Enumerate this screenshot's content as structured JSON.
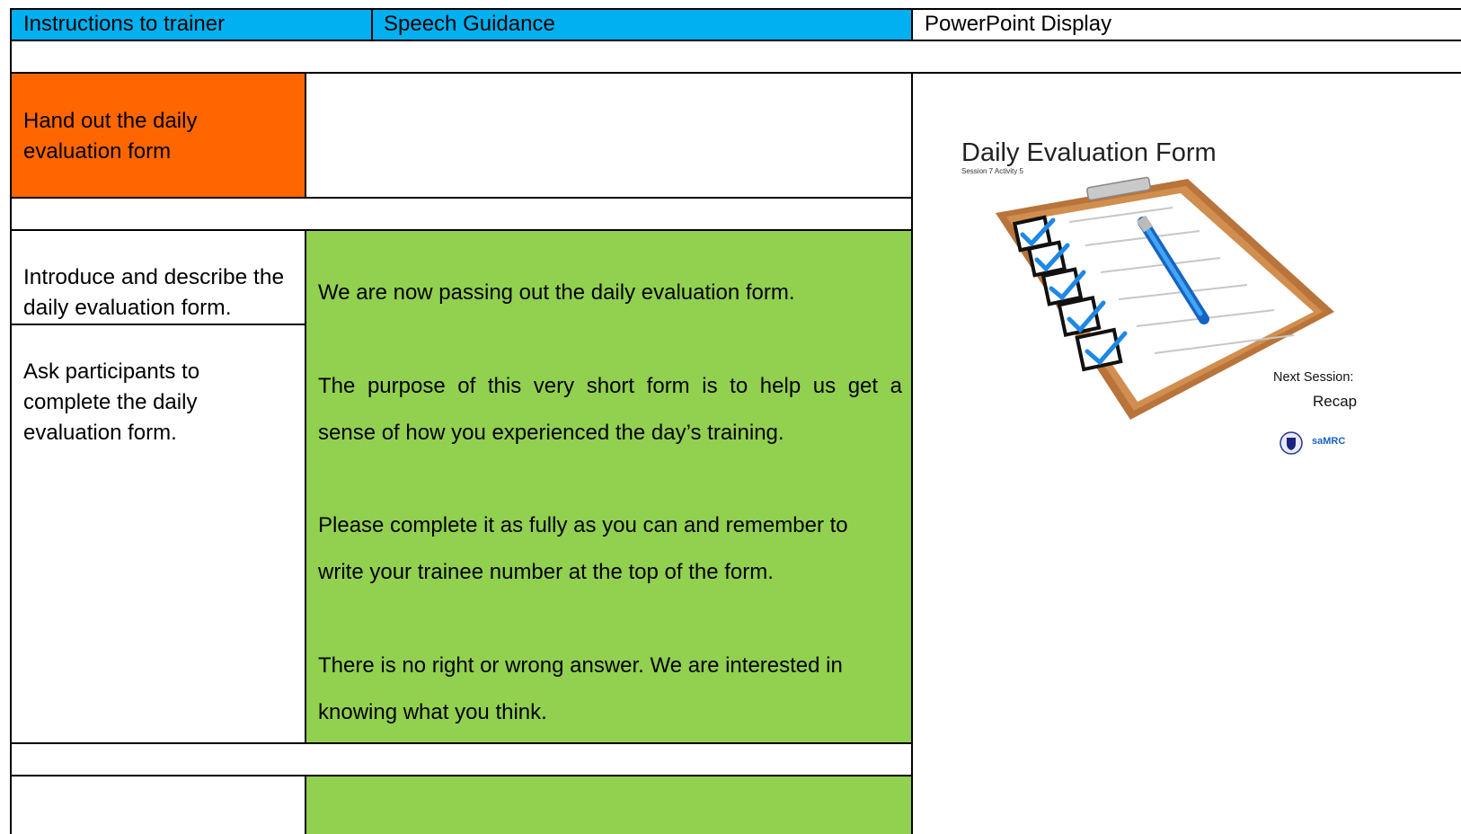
{
  "header": {
    "col_instructions": "Instructions to trainer",
    "col_speech": "Speech Guidance",
    "col_ppt": "PowerPoint Display"
  },
  "colors": {
    "header_blue": "#00b0f0",
    "orange": "#ff6600",
    "green": "#92d050"
  },
  "rows": {
    "handout": "Hand out the daily evaluation form",
    "introduce": "Introduce and describe the daily evaluation form.",
    "ask": "Ask participants to complete the daily evaluation form."
  },
  "speech": {
    "p1": "We are now passing out the daily evaluation form.",
    "p2a": "The purpose of this very short form is to help us get a",
    "p2b": "sense of how you experienced the day’s training.",
    "p3a": "Please complete it as fully as you can and remember to",
    "p3b": "write your trainee number at the top of the form.",
    "p4a": "There is no right or wrong answer.  We are interested in",
    "p4b": "knowing what you think."
  },
  "slide": {
    "title": "Daily Evaluation Form",
    "subtitle": "Session 7 Activity 5",
    "next_label": "Next Session:",
    "next_value": "Recap",
    "logo_text": "saMRC",
    "icon": "clipboard-checklist-icon"
  }
}
